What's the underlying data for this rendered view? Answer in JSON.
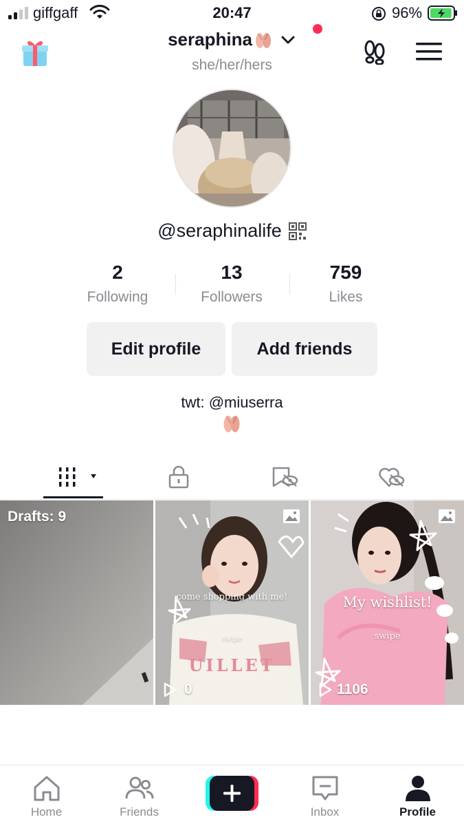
{
  "status_bar": {
    "carrier": "giffgaff",
    "time": "20:47",
    "battery_percent": "96%",
    "battery_level": 0.96,
    "signal_bars": 2
  },
  "header": {
    "username": "seraphina",
    "pronouns": "she/her/hers",
    "icons": [
      "gift-icon",
      "ballet-shoes-emoji",
      "chevron-down-icon",
      "footprints-icon",
      "menu-icon"
    ],
    "notification_dot_color": "#fe2c55"
  },
  "profile": {
    "handle": "@seraphinalife",
    "stats": [
      {
        "value": "2",
        "label": "Following"
      },
      {
        "value": "13",
        "label": "Followers"
      },
      {
        "value": "759",
        "label": "Likes"
      }
    ],
    "buttons": {
      "edit": "Edit profile",
      "add": "Add friends"
    },
    "bio": "twt: @miuserra"
  },
  "tabs": [
    "videos-grid-icon",
    "lock-icon",
    "bookmark-hidden-icon",
    "liked-hidden-icon"
  ],
  "grid": {
    "drafts_label": "Drafts: 9",
    "posts": [
      {
        "views": "0",
        "overlay_text": "come shopping with me!",
        "swipe_text": "swipe",
        "shirt_text": "UILLET"
      },
      {
        "views": "1106",
        "overlay_text": "My wishlist!",
        "swipe_text": "swipe"
      }
    ]
  },
  "bottom_nav": {
    "items": [
      {
        "label": "Home",
        "active": false
      },
      {
        "label": "Friends",
        "active": false
      },
      {
        "label": "",
        "active": false
      },
      {
        "label": "Inbox",
        "active": false
      },
      {
        "label": "Profile",
        "active": true
      }
    ]
  },
  "colors": {
    "accent_red": "#fe2c55",
    "accent_cyan": "#25f4ee",
    "text_primary": "#161823",
    "text_secondary": "#8a8b91",
    "button_bg": "#f1f1f2",
    "battery_green": "#4cd964"
  }
}
